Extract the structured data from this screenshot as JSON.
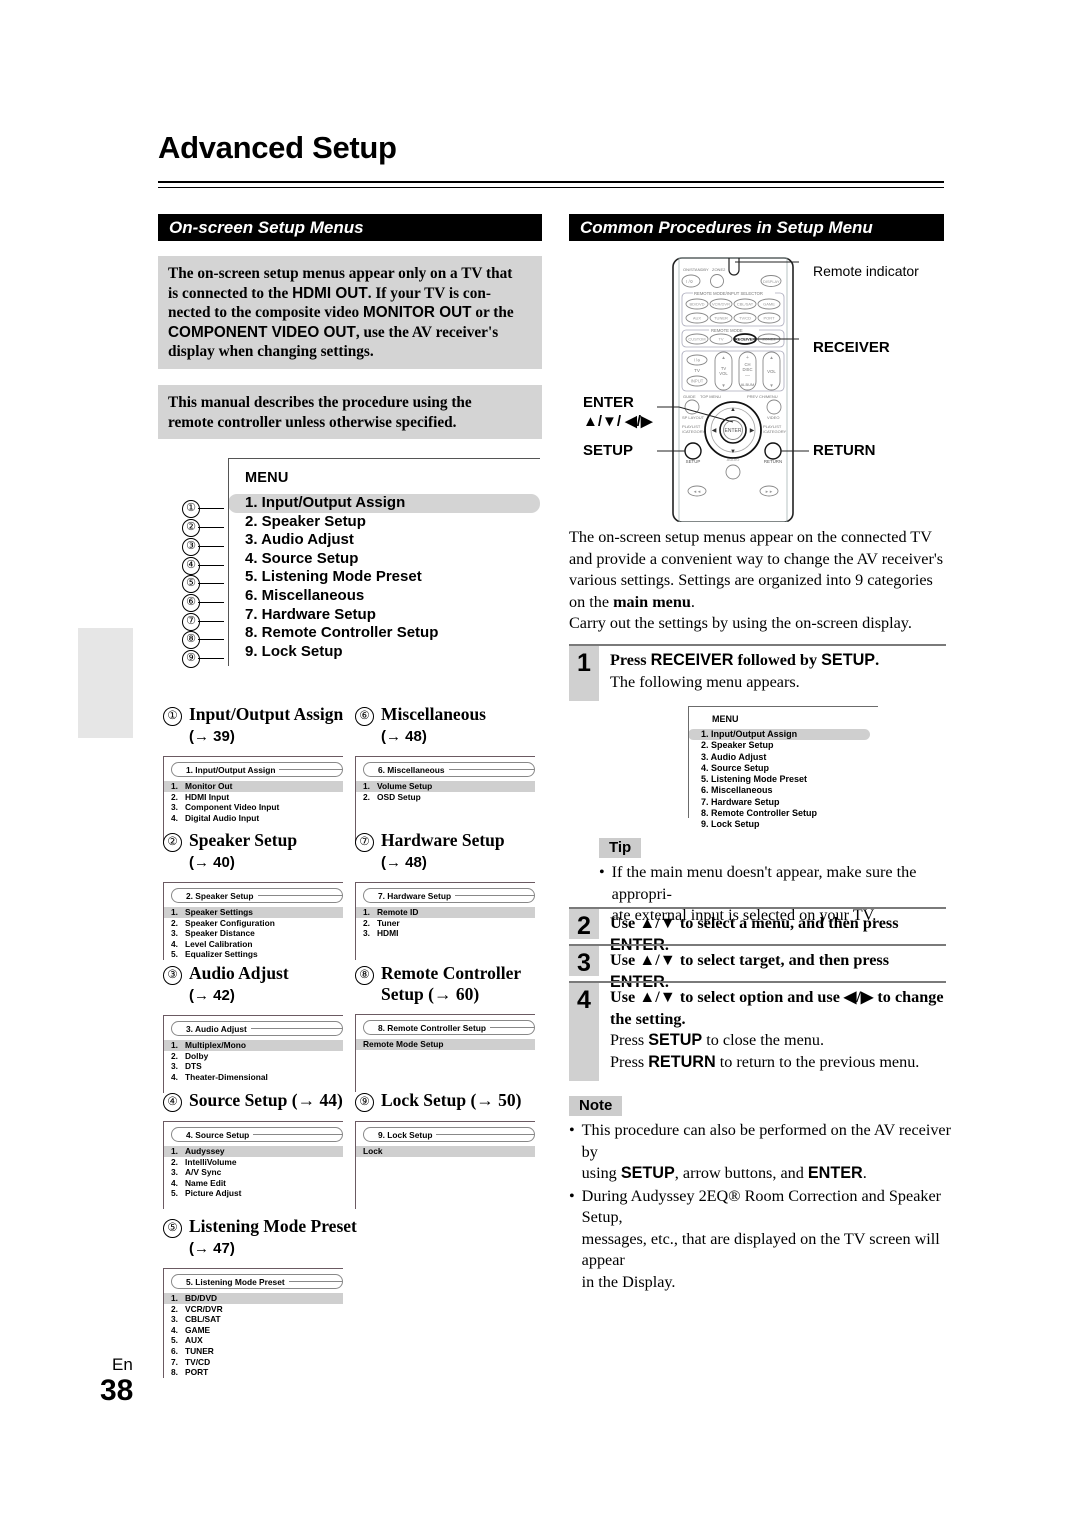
{
  "page": {
    "title": "Advanced Setup",
    "lang": "En",
    "number": "38"
  },
  "sections": {
    "left_header": "On-screen Setup Menus",
    "right_header": "Common Procedures in Setup Menu"
  },
  "notices": {
    "hdmi": {
      "line1": "The on-screen setup menus appear only on a TV that",
      "line2_a": "is connected to the ",
      "line2_b": "HDMI OUT",
      "line2_c": ". If your TV is con-",
      "line3_a": "nected to the composite video ",
      "line3_b": "MONITOR OUT",
      "line3_c": " or the",
      "line4_a": "COMPONENT VIDEO OUT",
      "line4_b": ", use the AV receiver's",
      "line5": "display when changing settings."
    },
    "manual": {
      "line1": "This manual describes the procedure using the",
      "line2": "remote controller unless otherwise specified."
    }
  },
  "menu_illustration": {
    "title": "MENU",
    "items": [
      {
        "n": "①",
        "label": "1. Input/Output Assign",
        "selected": true
      },
      {
        "n": "②",
        "label": "2. Speaker Setup",
        "selected": false
      },
      {
        "n": "③",
        "label": "3. Audio Adjust",
        "selected": false
      },
      {
        "n": "④",
        "label": "4. Source Setup",
        "selected": false
      },
      {
        "n": "⑤",
        "label": "5. Listening Mode Preset",
        "selected": false
      },
      {
        "n": "⑥",
        "label": "6. Miscellaneous",
        "selected": false
      },
      {
        "n": "⑦",
        "label": "7. Hardware Setup",
        "selected": false
      },
      {
        "n": "⑧",
        "label": "8. Remote Controller Setup",
        "selected": false
      },
      {
        "n": "⑨",
        "label": "9. Lock Setup",
        "selected": false
      }
    ]
  },
  "subsections": [
    {
      "num": "①",
      "heading": "Input/Output Assign",
      "page_ref": "(→ 39)",
      "shot_title": "1.   Input/Output Assign",
      "shot_items": [
        {
          "n": "1.",
          "label": "Monitor Out",
          "selected": true
        },
        {
          "n": "2.",
          "label": "HDMI Input",
          "selected": false
        },
        {
          "n": "3.",
          "label": "Component Video Input",
          "selected": false
        },
        {
          "n": "4.",
          "label": "Digital Audio Input",
          "selected": false
        }
      ]
    },
    {
      "num": "⑥",
      "heading": "Miscellaneous",
      "page_ref": "(→ 48)",
      "shot_title": "6.   Miscellaneous",
      "shot_items": [
        {
          "n": "1.",
          "label": "Volume Setup",
          "selected": true
        },
        {
          "n": "2.",
          "label": "OSD Setup",
          "selected": false
        }
      ]
    },
    {
      "num": "②",
      "heading": "Speaker Setup",
      "page_ref": "(→ 40)",
      "shot_title": "2.   Speaker Setup",
      "shot_items": [
        {
          "n": "1.",
          "label": "Speaker Settings",
          "selected": true
        },
        {
          "n": "2.",
          "label": "Speaker Configuration",
          "selected": false
        },
        {
          "n": "3.",
          "label": "Speaker Distance",
          "selected": false
        },
        {
          "n": "4.",
          "label": "Level Calibration",
          "selected": false
        },
        {
          "n": "5.",
          "label": "Equalizer Settings",
          "selected": false
        }
      ]
    },
    {
      "num": "⑦",
      "heading": "Hardware Setup",
      "page_ref": "(→ 48)",
      "shot_title": "7.   Hardware Setup",
      "shot_items": [
        {
          "n": "1.",
          "label": "Remote ID",
          "selected": true
        },
        {
          "n": "2.",
          "label": "Tuner",
          "selected": false
        },
        {
          "n": "3.",
          "label": "HDMI",
          "selected": false
        }
      ]
    },
    {
      "num": "③",
      "heading": "Audio Adjust",
      "page_ref": "(→ 42)",
      "shot_title": "3.   Audio Adjust",
      "shot_items": [
        {
          "n": "1.",
          "label": "Multiplex/Mono",
          "selected": true
        },
        {
          "n": "2.",
          "label": "Dolby",
          "selected": false
        },
        {
          "n": "3.",
          "label": "DTS",
          "selected": false
        },
        {
          "n": "4.",
          "label": "Theater-Dimensional",
          "selected": false
        }
      ]
    },
    {
      "num": "⑧",
      "heading": "Remote Controller",
      "heading2": "Setup (→ 60)",
      "page_ref": "",
      "shot_title": "8.   Remote Controller Setup",
      "shot_items": [
        {
          "n": "",
          "label": "Remote Mode Setup",
          "selected": true
        }
      ]
    },
    {
      "num": "④",
      "heading": "Source Setup (→ 44)",
      "page_ref": "",
      "shot_title": "4.   Source Setup",
      "shot_items": [
        {
          "n": "1.",
          "label": "Audyssey",
          "selected": true
        },
        {
          "n": "2.",
          "label": "IntelliVolume",
          "selected": false
        },
        {
          "n": "3.",
          "label": "A/V Sync",
          "selected": false
        },
        {
          "n": "4.",
          "label": "Name Edit",
          "selected": false
        },
        {
          "n": "5.",
          "label": "Picture Adjust",
          "selected": false
        }
      ]
    },
    {
      "num": "⑨",
      "heading": "Lock Setup (→ 50)",
      "page_ref": "",
      "shot_title": "9.   Lock Setup",
      "shot_items": [
        {
          "n": "",
          "label": "Lock",
          "selected": true
        }
      ]
    },
    {
      "num": "⑤",
      "heading": "Listening Mode Preset",
      "page_ref": "(→ 47)",
      "shot_title": "5.   Listening Mode Preset",
      "shot_items": [
        {
          "n": "1.",
          "label": "BD/DVD",
          "selected": true
        },
        {
          "n": "2.",
          "label": "VCR/DVR",
          "selected": false
        },
        {
          "n": "3.",
          "label": "CBL/SAT",
          "selected": false
        },
        {
          "n": "4.",
          "label": "GAME",
          "selected": false
        },
        {
          "n": "5.",
          "label": "AUX",
          "selected": false
        },
        {
          "n": "6.",
          "label": "TUNER",
          "selected": false
        },
        {
          "n": "7.",
          "label": "TV/CD",
          "selected": false
        },
        {
          "n": "8.",
          "label": "PORT",
          "selected": false
        }
      ]
    }
  ],
  "remote": {
    "callouts": {
      "indicator": "Remote indicator",
      "receiver": "RECEIVER",
      "enter": "ENTER",
      "enter_arrows": "▲/▼/ ◀/▶",
      "setup": "SETUP",
      "return": "RETURN"
    },
    "button_labels": {
      "onstandby": "ON/STANDBY",
      "zone2": "ZONE2",
      "display": "DISPLAY",
      "group1": "REMOTE MODE/INPUT SELECTOR",
      "group2": "REMOTE MODE",
      "bddvd": "BD/DVD",
      "vcrdvr": "VCR/DVR",
      "cblsat": "CBL/SAT",
      "game": "GAME",
      "aux": "AUX",
      "tuner": "TUNER",
      "tvcd": "TV/CD",
      "port": "PORT",
      "custom": "CUSTOM",
      "tv": "TV",
      "receiver": "RECEIVER",
      "zone2btn": "ZONE2",
      "tv_label": "TV",
      "input": "INPUT",
      "tvvol": "TV VOL",
      "chdisc": "CH DISC",
      "album": "ALBUM",
      "vol": "VOL",
      "guide": "GUIDE",
      "topmenu": "TOP MENU",
      "prevch": "PREV CH",
      "menu": "MENU",
      "splayout": "SP LAYOUT",
      "video": "VIDEO",
      "playlist": "PLAYLIST /CATEGORY",
      "enter": "ENTER",
      "setup": "SETUP",
      "audio": "AUDIO",
      "return": "RETURN"
    }
  },
  "right_body": {
    "p1_line1": "The on-screen setup menus appear on the connected TV",
    "p1_line2": "and provide a convenient way to change the AV receiver's",
    "p1_line3_a": "various settings. Settings are organized into 9 categories",
    "p1_line4_a": "on the ",
    "p1_line4_b": "main menu",
    "p1_line4_c": ".",
    "p2": "Carry out the settings by using the on-screen display."
  },
  "steps": [
    {
      "num": "1",
      "bold_a": "Press ",
      "sans_a": "RECEIVER",
      "bold_b": " followed by ",
      "sans_b": "SETUP",
      "bold_c": ".",
      "sub": "The following menu appears."
    },
    {
      "num": "2",
      "line_a": "Use ",
      "arrows": "▲/▼",
      "line_b": " to select a menu, and then press ",
      "sans": "ENTER",
      "line_c": "."
    },
    {
      "num": "3",
      "line_a": "Use ",
      "arrows": "▲/▼",
      "line_b": " to select target, and then press ",
      "sans": "ENTER",
      "line_c": "."
    },
    {
      "num": "4",
      "line_a": "Use ",
      "arrows": "▲/▼",
      "line_b": " to select option and use ",
      "arrows2": "◀/▶",
      "line_c": " to change",
      "line_d": "the setting.",
      "sub1_a": "Press ",
      "sub1_s": "SETUP",
      "sub1_b": " to close the menu.",
      "sub2_a": "Press ",
      "sub2_s": "RETURN",
      "sub2_b": " to return to the previous menu."
    }
  ],
  "menu_screenshot": {
    "title": "MENU",
    "items": [
      {
        "label": "1. Input/Output Assign",
        "selected": true
      },
      {
        "label": "2. Speaker Setup",
        "selected": false
      },
      {
        "label": "3. Audio Adjust",
        "selected": false
      },
      {
        "label": "4. Source Setup",
        "selected": false
      },
      {
        "label": "5. Listening Mode Preset",
        "selected": false
      },
      {
        "label": "6. Miscellaneous",
        "selected": false
      },
      {
        "label": "7. Hardware Setup",
        "selected": false
      },
      {
        "label": "8. Remote Controller Setup",
        "selected": false
      },
      {
        "label": "9. Lock Setup",
        "selected": false
      }
    ]
  },
  "tip": {
    "label": "Tip",
    "bullet1_l1": "If the main menu doesn't appear, make sure the appropri-",
    "bullet1_l2": "ate external input is selected on your TV."
  },
  "note": {
    "label": "Note",
    "bullet1_a": "This procedure can also be performed on the AV receiver by",
    "bullet1_b": "using ",
    "bullet1_s1": "SETUP",
    "bullet1_c": ", arrow buttons, and ",
    "bullet1_s2": "ENTER",
    "bullet1_d": ".",
    "bullet2_l1": "During Audyssey 2EQ® Room Correction and Speaker Setup,",
    "bullet2_l2": "messages, etc., that are displayed on the TV screen will appear",
    "bullet2_l3": "in the Display."
  }
}
